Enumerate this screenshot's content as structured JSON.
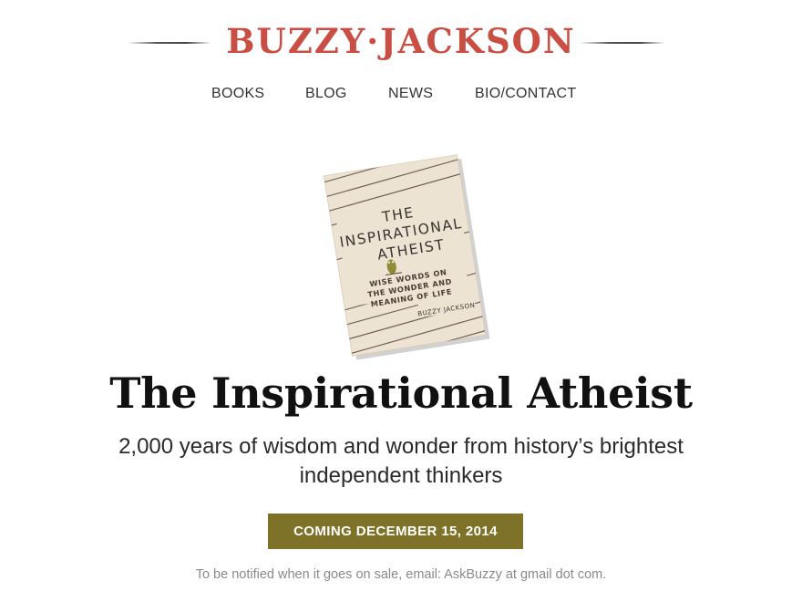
{
  "site": {
    "logo_text": "BUZZY·JACKSON"
  },
  "nav": {
    "items": [
      "BOOKS",
      "BLOG",
      "NEWS",
      "BIO/CONTACT"
    ]
  },
  "book": {
    "cover": {
      "title_lines": [
        "THE",
        "INSPIRATIONAL",
        "ATHEIST"
      ],
      "subtitle_lines": [
        "WISE WORDS ON",
        "THE WONDER AND",
        "MEANING OF LIFE"
      ],
      "author": "BUZZY JACKSON"
    },
    "title": "The Inspirational Atheist",
    "subtitle": "2,000 years of wisdom and wonder from history’s brightest independent thinkers",
    "release_badge": "COMING DECEMBER 15, 2014",
    "notify_text": "To be notified when it goes on sale, email: AskBuzzy at gmail dot com."
  },
  "colors": {
    "logo_red": "#c1352a",
    "badge_olive": "#7d7228",
    "cover_paper": "#ede3d3",
    "owl_green": "#8f8c34"
  }
}
